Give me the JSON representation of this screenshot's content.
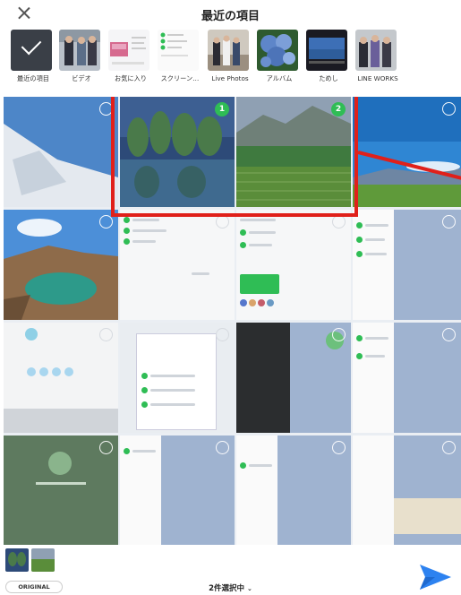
{
  "header": {
    "title": "最近の項目",
    "close_icon": "close-icon"
  },
  "albums": [
    {
      "label": "最近の項目",
      "selected": true
    },
    {
      "label": "ビデオ"
    },
    {
      "label": "お気に入り"
    },
    {
      "label": "スクリーン…"
    },
    {
      "label": "Live Photos"
    },
    {
      "label": "アルバム"
    },
    {
      "label": "ためし"
    },
    {
      "label": "LINE WORKS"
    }
  ],
  "grid": {
    "selected": [
      {
        "number": "1"
      },
      {
        "number": "2"
      }
    ]
  },
  "bottom": {
    "original_label": "ORIGINAL",
    "selection_count": "2件選択中",
    "send_icon": "send-icon"
  },
  "colors": {
    "accent_green": "#2fbd55",
    "highlight_red": "#e0201a",
    "send_blue": "#2d82f0"
  }
}
